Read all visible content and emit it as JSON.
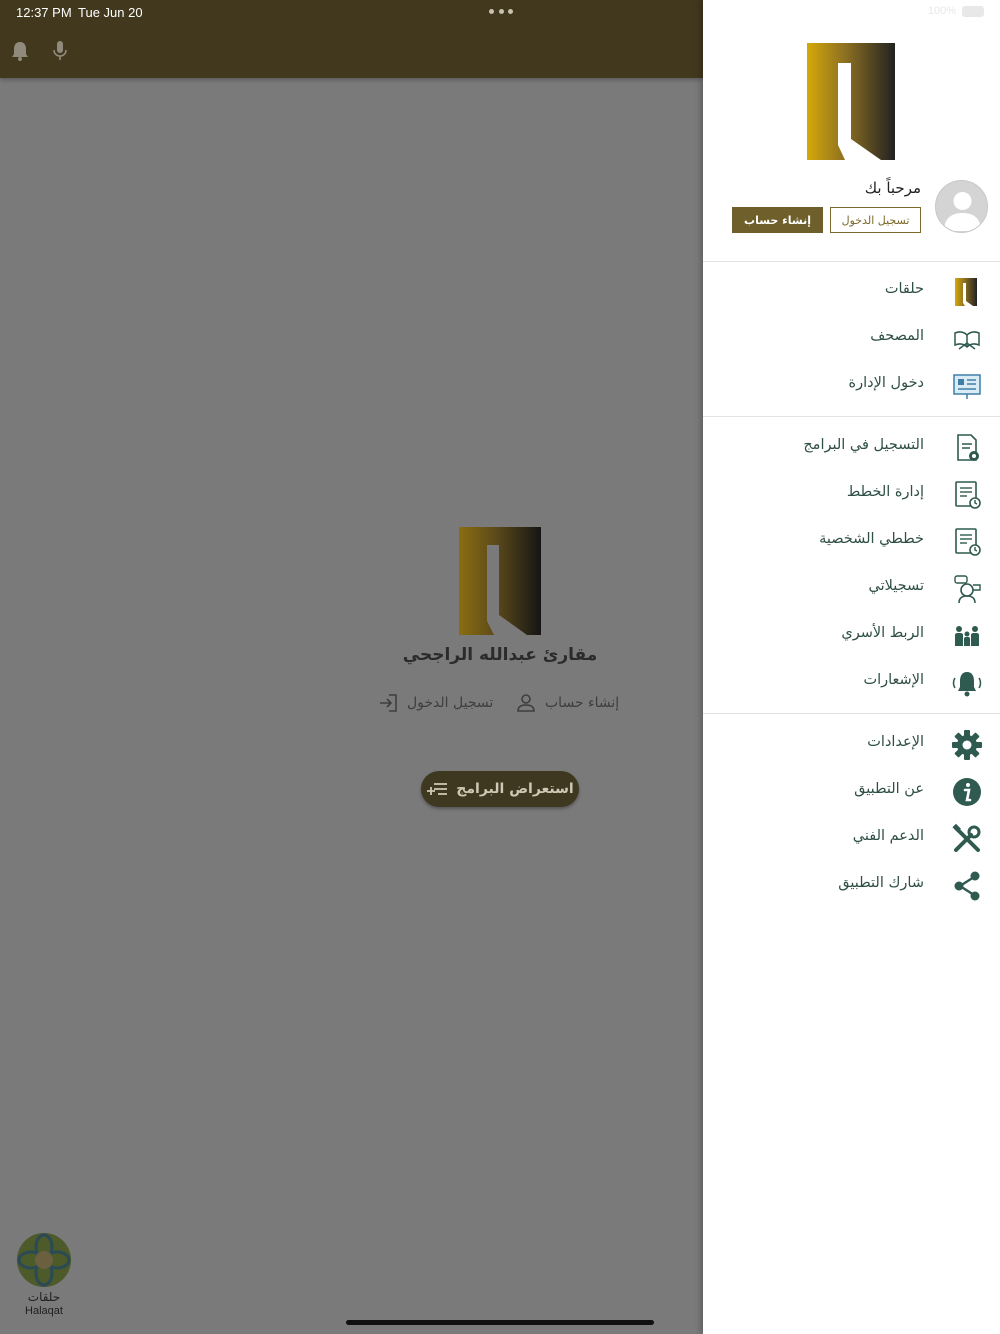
{
  "status_bar": {
    "time": "12:37 PM",
    "date": "Tue Jun 20",
    "battery": "100%"
  },
  "background_app": {
    "brand_name": "مقارئ عبدالله الراجحي",
    "create_account_link": "إنشاء حساب",
    "login_link": "تسجيل الدخول",
    "browse_programs_button": "استعراض البرامج",
    "bottom_logo_label_ar": "حلقات",
    "bottom_logo_label_en": "Halaqat"
  },
  "drawer": {
    "welcome": "مرحباً بك",
    "login_button": "تسجيل الدخول",
    "signup_button": "إنشاء حساب",
    "section1": [
      {
        "label": "حلقات",
        "icon": "halaqat-logo-icon"
      },
      {
        "label": "المصحف",
        "icon": "open-book-icon"
      },
      {
        "label": "دخول الإدارة",
        "icon": "admin-board-icon"
      }
    ],
    "section2": [
      {
        "label": "التسجيل في البرامج",
        "icon": "doc-gear-icon"
      },
      {
        "label": "إدارة الخطط",
        "icon": "doc-clock-icon"
      },
      {
        "label": "خططي الشخصية",
        "icon": "doc-clock-icon"
      },
      {
        "label": "تسجيلاتي",
        "icon": "reciter-icon"
      },
      {
        "label": "الربط الأسري",
        "icon": "family-icon"
      },
      {
        "label": "الإشعارات",
        "icon": "bell-icon"
      }
    ],
    "section3": [
      {
        "label": "الإعدادات",
        "icon": "gear-icon"
      },
      {
        "label": "عن التطبيق",
        "icon": "info-icon"
      },
      {
        "label": "الدعم الفني",
        "icon": "tools-icon"
      },
      {
        "label": "شارك التطبيق",
        "icon": "share-icon"
      }
    ]
  },
  "colors": {
    "header_brown": "#41381d",
    "accent_gold": "#6f5f2b",
    "menu_green": "#2e4f46",
    "icon_green": "#2f5a4f"
  }
}
